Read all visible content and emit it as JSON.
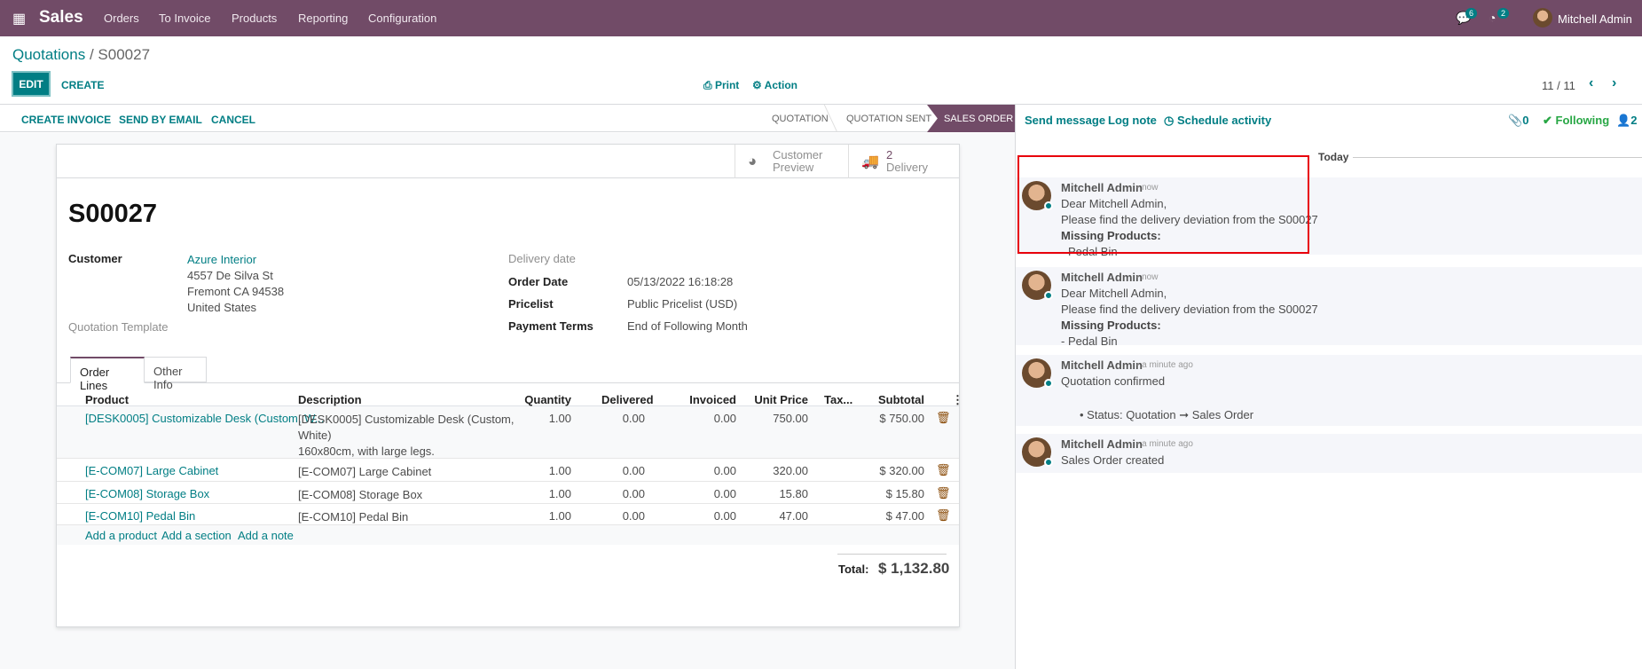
{
  "nav": {
    "app": "Sales",
    "menu": [
      "Orders",
      "To Invoice",
      "Products",
      "Reporting",
      "Configuration"
    ],
    "messages_count": "6",
    "activities_count": "2",
    "user": "Mitchell Admin",
    "color": "#714B67"
  },
  "breadcrumb": {
    "parent": "Quotations",
    "current": "S00027"
  },
  "controls": {
    "edit": "EDIT",
    "create": "CREATE",
    "print": "Print",
    "action": "Action",
    "pager": "11 / 11"
  },
  "status_actions": [
    "CREATE INVOICE",
    "SEND BY EMAIL",
    "CANCEL"
  ],
  "stages": [
    "QUOTATION",
    "QUOTATION SENT",
    "SALES ORDER"
  ],
  "active_stage": "SALES ORDER",
  "chatter_tools": {
    "send": "Send message",
    "log": "Log note",
    "schedule": "Schedule activity",
    "attachments": "0",
    "following": "Following",
    "followers": "2"
  },
  "smart_buttons": {
    "preview_1": "Customer",
    "preview_2": "Preview",
    "delivery_count": "2",
    "delivery_label": "Delivery"
  },
  "form": {
    "name": "S00027",
    "customer_label": "Customer",
    "customer": "Azure Interior",
    "address": [
      "4557 De Silva St",
      "Fremont CA 94538",
      "United States"
    ],
    "template_label": "Quotation Template",
    "delivery_label": "Delivery date",
    "order_date_label": "Order Date",
    "order_date": "05/13/2022 16:18:28",
    "pricelist_label": "Pricelist",
    "pricelist": "Public Pricelist (USD)",
    "terms_label": "Payment Terms",
    "terms": "End of Following Month"
  },
  "tabs": [
    "Order Lines",
    "Other Info"
  ],
  "table": {
    "headers": [
      "Product",
      "Description",
      "Quantity",
      "Delivered",
      "Invoiced",
      "Unit Price",
      "Tax...",
      "Subtotal"
    ],
    "rows": [
      {
        "product": "[DESK0005] Customizable Desk (Custom, W...",
        "desc": [
          "[DESK0005] Customizable Desk (Custom,",
          "White)",
          "160x80cm, with large legs."
        ],
        "qty": "1.00",
        "delivered": "0.00",
        "invoiced": "0.00",
        "price": "750.00",
        "subtotal": "$ 750.00"
      },
      {
        "product": "[E-COM07] Large Cabinet",
        "desc": [
          "[E-COM07] Large Cabinet"
        ],
        "qty": "1.00",
        "delivered": "0.00",
        "invoiced": "0.00",
        "price": "320.00",
        "subtotal": "$ 320.00"
      },
      {
        "product": "[E-COM08] Storage Box",
        "desc": [
          "[E-COM08] Storage Box"
        ],
        "qty": "1.00",
        "delivered": "0.00",
        "invoiced": "0.00",
        "price": "15.80",
        "subtotal": "$ 15.80"
      },
      {
        "product": "[E-COM10] Pedal Bin",
        "desc": [
          "[E-COM10] Pedal Bin"
        ],
        "qty": "1.00",
        "delivered": "0.00",
        "invoiced": "0.00",
        "price": "47.00",
        "subtotal": "$ 47.00"
      }
    ],
    "add": [
      "Add a product",
      "Add a section",
      "Add a note"
    ],
    "total_label": "Total:",
    "total": "$ 1,132.80"
  },
  "chatter": {
    "date": "Today",
    "messages": [
      {
        "author": "Mitchell Admin",
        "time": "- now",
        "lines": [
          "Dear Mitchell Admin,",
          "Please find the delivery deviation from the S00027"
        ],
        "bold": "Missing Products:",
        "tail": "- Pedal Bin"
      },
      {
        "author": "Mitchell Admin",
        "time": "- now",
        "lines": [
          "Dear Mitchell Admin,",
          "Please find the delivery deviation from the S00027"
        ],
        "bold": "Missing Products:",
        "tail": "- Pedal Bin"
      },
      {
        "author": "Mitchell Admin",
        "time": "- a minute ago",
        "lines": [
          "Quotation confirmed"
        ],
        "bullet": "Status: Quotation ➞ Sales Order"
      },
      {
        "author": "Mitchell Admin",
        "time": "- a minute ago",
        "lines": [
          "Sales Order created"
        ]
      }
    ]
  },
  "highlight_color": "#e8000b"
}
